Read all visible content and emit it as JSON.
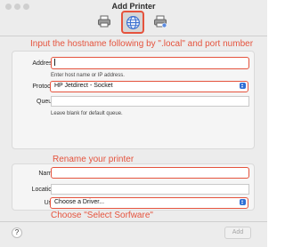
{
  "window": {
    "title": "Add Printer"
  },
  "toolbar": {
    "buttons": [
      {
        "name": "default",
        "icon": "printer-icon"
      },
      {
        "name": "ip",
        "icon": "globe-icon",
        "selected": true
      },
      {
        "name": "windows",
        "icon": "printer-share-icon"
      }
    ]
  },
  "annotations": {
    "hostname": "Input the hostname following by \".local\" and port number",
    "rename": "Rename your printer",
    "choose": "Choose \"Select Sorfware\""
  },
  "connection": {
    "address_label": "Address:",
    "address_value": "",
    "address_hint": "Enter host name or IP address.",
    "protocol_label": "Protocol:",
    "protocol_value": "HP Jetdirect - Socket",
    "queue_label": "Queue:",
    "queue_value": "",
    "queue_hint": "Leave blank for default queue."
  },
  "details": {
    "name_label": "Name:",
    "name_value": "",
    "location_label": "Location:",
    "location_value": "",
    "use_label": "Use:",
    "use_value": "Choose a Driver..."
  },
  "footer": {
    "help": "?",
    "add_label": "Add"
  },
  "colors": {
    "annotation": "#e5533d",
    "accent": "#2f6fd6"
  }
}
